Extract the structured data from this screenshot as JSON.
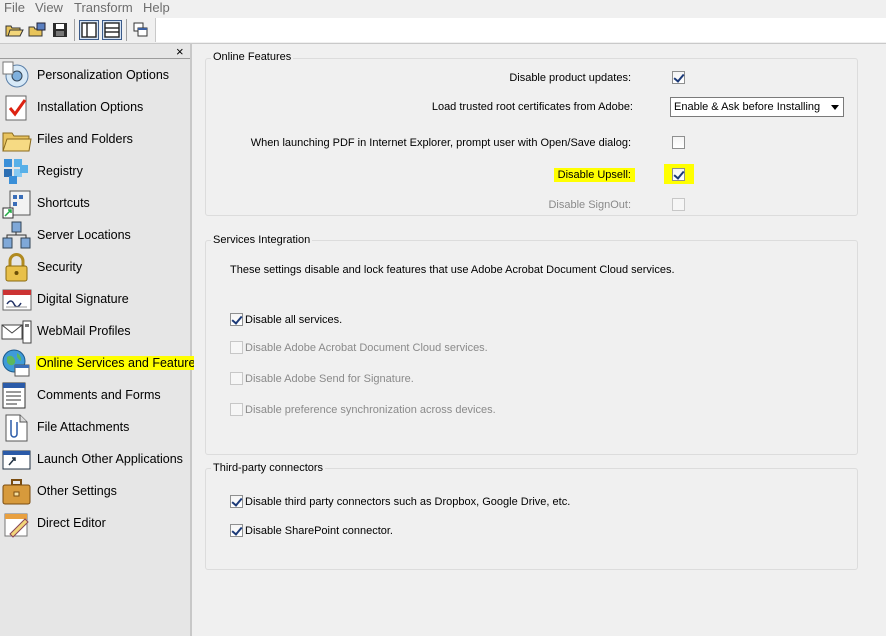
{
  "menu": {
    "items": [
      "File",
      "View",
      "Transform",
      "Help"
    ]
  },
  "toolbar": {
    "buttons": [
      "open-folder-icon",
      "save-package-icon",
      "save-icon",
      "left-layout-icon",
      "split-layout-icon",
      "window-copy-icon"
    ]
  },
  "sidebar": {
    "close_glyph": "×",
    "items": [
      {
        "label": "Personalization Options",
        "icon": "personalization-icon"
      },
      {
        "label": "Installation Options",
        "icon": "installation-icon"
      },
      {
        "label": "Files and Folders",
        "icon": "folder-icon"
      },
      {
        "label": "Registry",
        "icon": "registry-icon"
      },
      {
        "label": "Shortcuts",
        "icon": "shortcuts-icon"
      },
      {
        "label": "Server Locations",
        "icon": "server-icon"
      },
      {
        "label": "Security",
        "icon": "lock-icon"
      },
      {
        "label": "Digital Signature",
        "icon": "signature-icon"
      },
      {
        "label": "WebMail Profiles",
        "icon": "mail-icon"
      },
      {
        "label": "Online Services and Features",
        "icon": "globe-icon"
      },
      {
        "label": "Comments and Forms",
        "icon": "comments-icon"
      },
      {
        "label": "File Attachments",
        "icon": "attachment-icon"
      },
      {
        "label": "Launch Other Applications",
        "icon": "launch-icon"
      },
      {
        "label": "Other Settings",
        "icon": "briefcase-icon"
      },
      {
        "label": "Direct Editor",
        "icon": "editor-icon"
      }
    ],
    "selected_index": 9,
    "highlight_color": "#ffff00"
  },
  "online_features": {
    "title": "Online Features",
    "rows": [
      {
        "label": "Disable product updates:",
        "checked": true,
        "enabled": true
      },
      {
        "label": "Load trusted root certificates from Adobe:",
        "select_value": "Enable & Ask before Installing"
      },
      {
        "label": "When launching PDF in Internet Explorer, prompt user with Open/Save dialog:",
        "checked": false,
        "enabled": true
      },
      {
        "label": "Disable Upsell:",
        "checked": true,
        "enabled": true,
        "highlighted": true
      },
      {
        "label": "Disable SignOut:",
        "checked": false,
        "enabled": false
      }
    ]
  },
  "services_integration": {
    "title": "Services Integration",
    "info": "These settings disable and lock features that use Adobe Acrobat Document Cloud services.",
    "options": [
      {
        "label": "Disable all services.",
        "checked": true,
        "enabled": true
      },
      {
        "label": "Disable Adobe Acrobat Document Cloud services.",
        "checked": false,
        "enabled": false
      },
      {
        "label": "Disable Adobe Send for Signature.",
        "checked": false,
        "enabled": false
      },
      {
        "label": "Disable preference synchronization across devices.",
        "checked": false,
        "enabled": false
      }
    ]
  },
  "third_party": {
    "title": "Third-party connectors",
    "options": [
      {
        "label": "Disable third party connectors such as Dropbox, Google Drive, etc.",
        "checked": true,
        "enabled": true
      },
      {
        "label": "Disable SharePoint connector.",
        "checked": true,
        "enabled": true
      }
    ]
  }
}
